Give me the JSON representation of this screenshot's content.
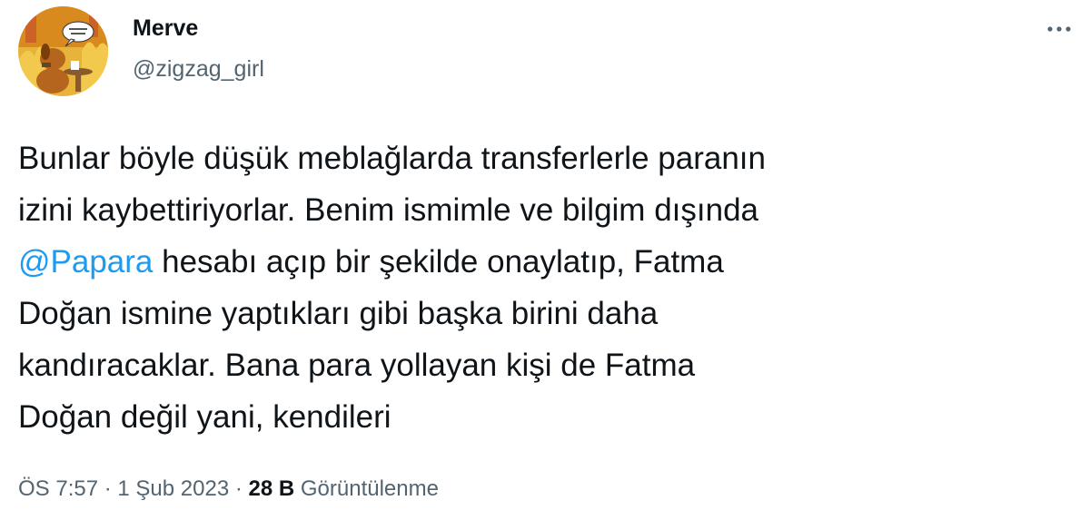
{
  "author": {
    "display_name": "Merve",
    "handle": "@zigzag_girl",
    "avatar_icon": "this-is-fine-dog-avatar"
  },
  "more_menu": {
    "icon": "more-horizontal-icon"
  },
  "tweet": {
    "lines": [
      {
        "segments": [
          "Bunlar böyle düşük meblağlarda transferlerle paranın"
        ]
      },
      {
        "segments": [
          "izini kaybettiriyorlar. Benim ismimle ve bilgim dışında"
        ]
      },
      {
        "mention": "@Papara",
        "rest": " hesabı açıp bir şekilde onaylatıp, Fatma"
      },
      {
        "segments": [
          "Doğan ismine yaptıkları gibi başka birini daha"
        ]
      },
      {
        "segments": [
          "kandıracaklar. Bana para yollayan kişi de Fatma"
        ]
      },
      {
        "segments": [
          "Doğan değil yani, kendileri"
        ]
      }
    ]
  },
  "meta": {
    "time": "ÖS 7:57",
    "separator": " · ",
    "date": "1 Şub 2023",
    "views_count": "28 B",
    "views_label": " Görüntülenme"
  },
  "colors": {
    "text": "#0f1419",
    "secondary": "#536471",
    "link": "#1d9bf0"
  }
}
